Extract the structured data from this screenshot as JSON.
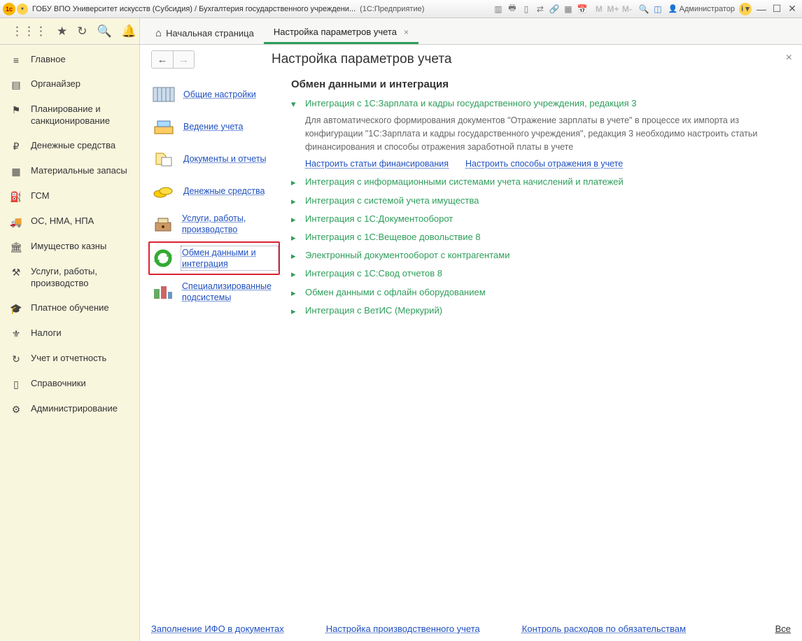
{
  "titlebar": {
    "title": "ГОБУ ВПО Университет искусств (Субсидия) / Бухгалтерия государственного учреждени...",
    "product": "(1С:Предприятие)",
    "user": "Администратор",
    "m_buttons": [
      "M",
      "M+",
      "M-"
    ]
  },
  "toolbar": {
    "tabs": [
      {
        "label": "Начальная страница",
        "home": true
      },
      {
        "label": "Настройка параметров учета",
        "active": true
      }
    ]
  },
  "sidebar": {
    "items": [
      {
        "icon": "≡",
        "label": "Главное"
      },
      {
        "icon": "▤",
        "label": "Органайзер"
      },
      {
        "icon": "⚑",
        "label": "Планирование и санкционирование"
      },
      {
        "icon": "₽",
        "label": "Денежные средства"
      },
      {
        "icon": "▦",
        "label": "Материальные запасы"
      },
      {
        "icon": "⛽",
        "label": "ГСМ"
      },
      {
        "icon": "🚚",
        "label": "ОС, НМА, НПА"
      },
      {
        "icon": "🏛",
        "label": "Имущество казны"
      },
      {
        "icon": "⚒",
        "label": "Услуги, работы, производство"
      },
      {
        "icon": "🎓",
        "label": "Платное обучение"
      },
      {
        "icon": "⚜",
        "label": "Налоги"
      },
      {
        "icon": "↻",
        "label": "Учет и отчетность"
      },
      {
        "icon": "▯",
        "label": "Справочники"
      },
      {
        "icon": "⚙",
        "label": "Администрирование"
      }
    ]
  },
  "page": {
    "title": "Настройка параметров учета",
    "categories": [
      {
        "label": "Общие настройки"
      },
      {
        "label": "Ведение учета"
      },
      {
        "label": "Документы и отчеты"
      },
      {
        "label": "Денежные средства"
      },
      {
        "label": "Услуги, работы, производство"
      },
      {
        "label": "Обмен данными и интеграция",
        "selected": true
      },
      {
        "label": "Специализированные подсистемы"
      }
    ],
    "section_title": "Обмен данными и интеграция",
    "expanded": {
      "title": "Интеграция с 1С:Зарплата и кадры государственного учреждения, редакция 3",
      "desc": "Для автоматического формирования документов \"Отражение зарплаты в учете\" в процессе их импорта из конфигурации \"1С:Зарплата и кадры государственного учреждения\", редакция 3 необходимо настроить  статьи финансирования и способы отражения заработной платы в учете",
      "link1": "Настроить статьи финансирования",
      "link2": "Настроить способы отражения в учете"
    },
    "collapsed": [
      "Интеграция с информационными системами учета начислений и платежей",
      "Интеграция с системой учета имущества",
      "Интеграция с 1С:Документооборот",
      "Интеграция с 1С:Вещевое довольствие 8",
      "Электронный документооборот с контрагентами",
      "Интеграция с 1С:Свод отчетов 8",
      "Обмен данными с офлайн оборудованием",
      "Интеграция с ВетИС (Меркурий)"
    ],
    "footer": {
      "link1": "Заполнение ИФО в документах",
      "link2": "Настройка производственного учета",
      "link3": "Контроль расходов по обязательствам",
      "all": "Все"
    }
  }
}
